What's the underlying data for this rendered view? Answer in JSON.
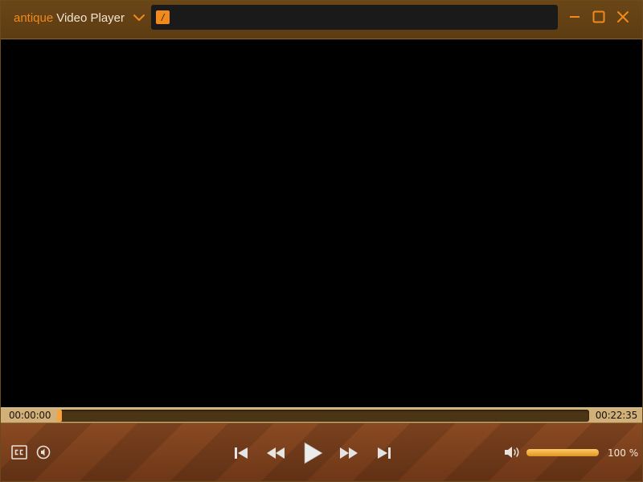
{
  "titlebar": {
    "brand": "antique",
    "app_name": "Video Player",
    "path": "/",
    "menu_icon": "chevron-down-icon",
    "buttons": {
      "minimize_icon": "minimize-icon",
      "maximize_icon": "maximize-icon",
      "close_icon": "close-icon"
    }
  },
  "playback": {
    "current_time": "00:00:00",
    "total_time": "00:22:35",
    "progress_fraction": 0.0
  },
  "controls": {
    "left": [
      {
        "icon": "closed-captions-icon"
      },
      {
        "icon": "audio-track-icon"
      }
    ],
    "center": [
      {
        "icon": "skip-previous-icon"
      },
      {
        "icon": "rewind-icon"
      },
      {
        "icon": "play-icon"
      },
      {
        "icon": "fast-forward-icon"
      },
      {
        "icon": "skip-next-icon"
      }
    ],
    "volume": {
      "icon": "volume-icon",
      "level_percent": 100,
      "label": "100 %"
    }
  },
  "colors": {
    "accent": "#f08a1c",
    "titlebar_bg": "#6a4617",
    "seekbar_bg": "#d1b07a",
    "controls_bg": "#7e4220"
  }
}
